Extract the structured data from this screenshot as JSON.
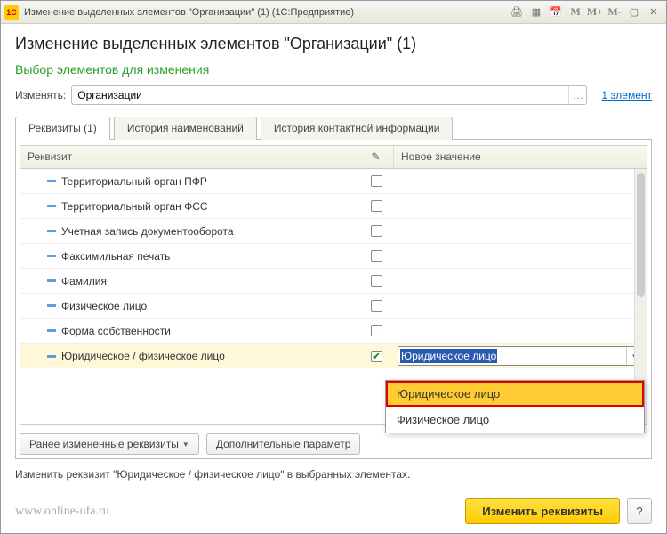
{
  "titlebar": {
    "app_icon": "1C",
    "title": "Изменение выделенных элементов \"Организации\" (1) (1С:Предприятие)",
    "m": "M",
    "mplus": "M+",
    "mminus": "M-"
  },
  "header": {
    "h1": "Изменение выделенных элементов \"Организации\" (1)",
    "sub": "Выбор элементов для изменения",
    "change_label": "Изменять:",
    "change_value": "Организации",
    "count_link": "1 элемент"
  },
  "tabs": [
    {
      "label": "Реквизиты (1)"
    },
    {
      "label": "История наименований"
    },
    {
      "label": "История контактной информации"
    }
  ],
  "grid": {
    "col_requisite": "Реквизит",
    "col_newvalue": "Новое значение",
    "rows": [
      {
        "label": "Территориальный орган ПФР",
        "checked": false
      },
      {
        "label": "Территориальный орган ФСС",
        "checked": false
      },
      {
        "label": "Учетная запись документооборота",
        "checked": false
      },
      {
        "label": "Факсимильная печать",
        "checked": false
      },
      {
        "label": "Фамилия",
        "checked": false
      },
      {
        "label": "Физическое лицо",
        "checked": false
      },
      {
        "label": "Форма собственности",
        "checked": false
      },
      {
        "label": "Юридическое / физическое лицо",
        "checked": true
      }
    ],
    "selected_value": "Юридическое лицо"
  },
  "dropdown": {
    "options": [
      {
        "label": "Юридическое лицо",
        "highlighted": true
      },
      {
        "label": "Физическое лицо",
        "highlighted": false
      }
    ]
  },
  "buttons": {
    "prev_changed": "Ранее измененные реквизиты",
    "extra_params": "Дополнительные параметр"
  },
  "status": "Изменить реквизит \"Юридическое / физическое лицо\" в выбранных элементах.",
  "footer": {
    "watermark": "www.online-ufa.ru",
    "primary": "Изменить реквизиты",
    "help": "?"
  }
}
